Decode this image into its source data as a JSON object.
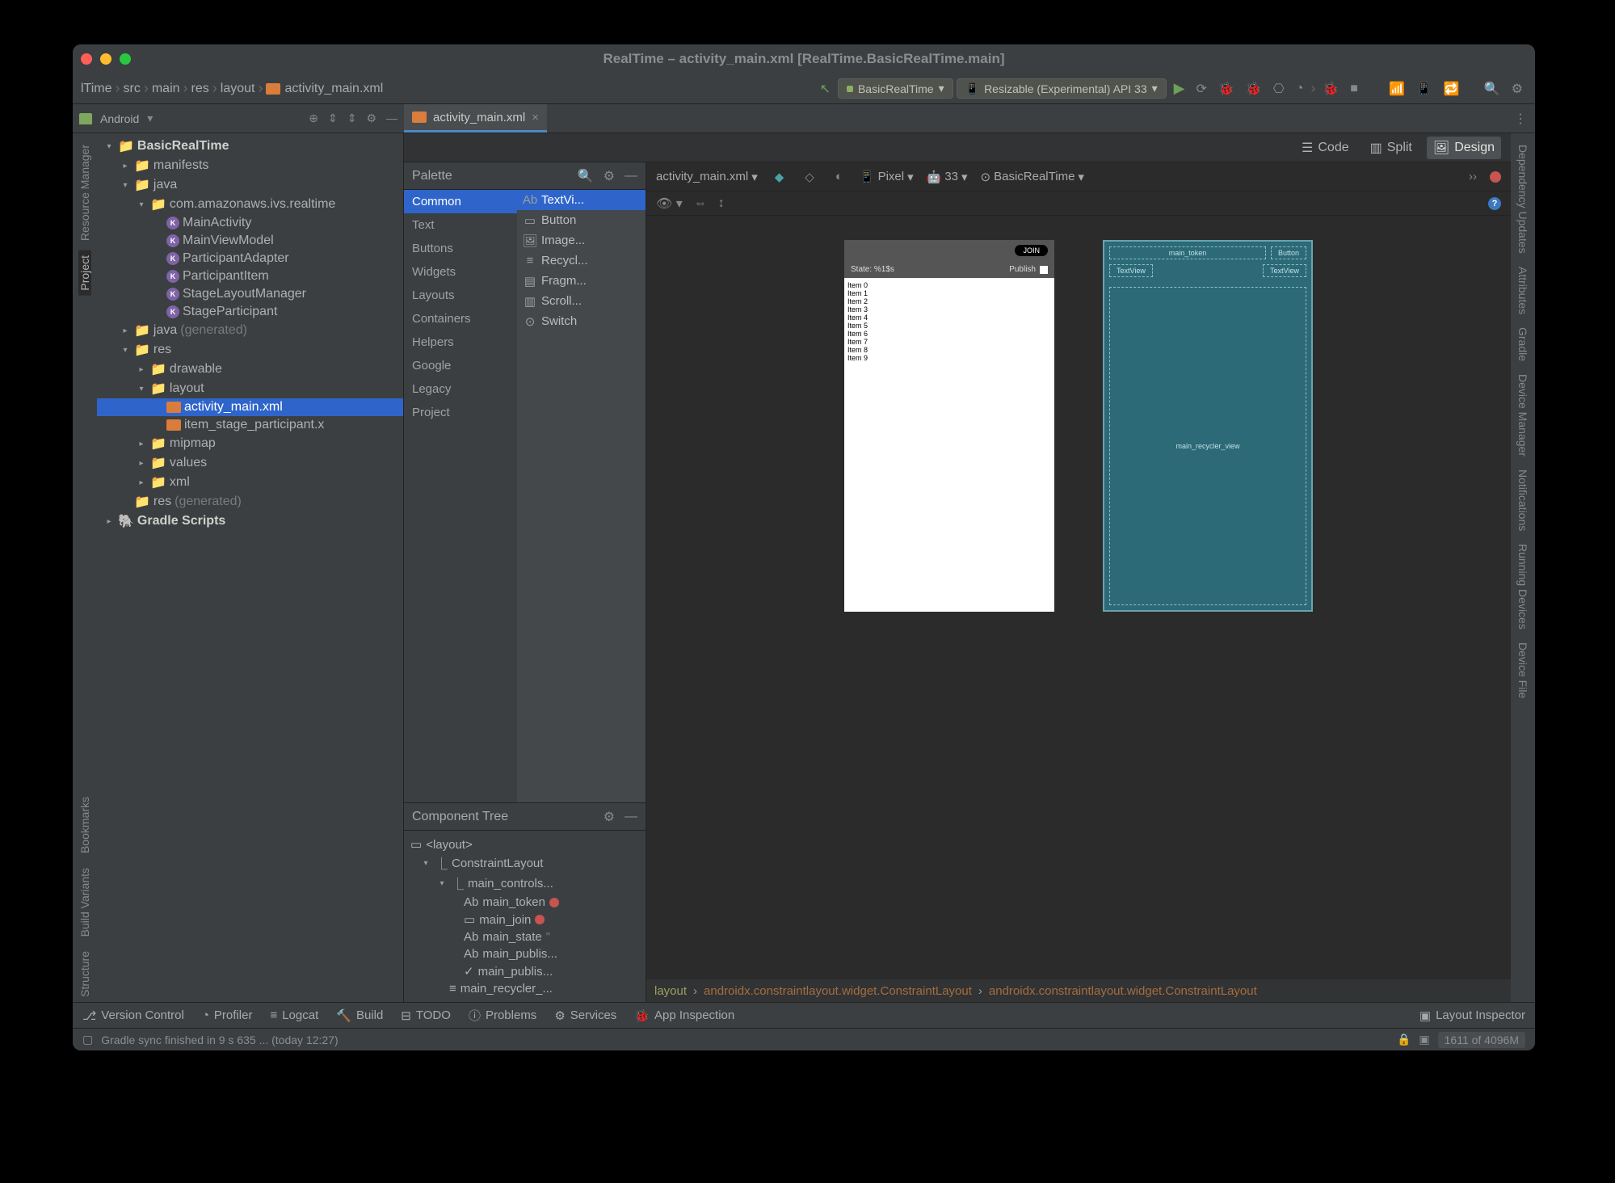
{
  "title": "RealTime – activity_main.xml [RealTime.BasicRealTime.main]",
  "breadcrumbs": {
    "p0": "lTime",
    "p1": "src",
    "p2": "main",
    "p3": "res",
    "p4": "layout",
    "p5": "activity_main.xml"
  },
  "runconfig": {
    "module": "BasicRealTime",
    "device": "Resizable (Experimental) API 33"
  },
  "topbar": {
    "android": "Android",
    "tab": "activity_main.xml"
  },
  "rails_left": {
    "rm": "Resource Manager",
    "prj": "Project",
    "bm": "Bookmarks",
    "bv": "Build Variants",
    "st": "Structure"
  },
  "rails_right": {
    "du": "Dependency Updates",
    "attr": "Attributes",
    "gr": "Gradle",
    "dm": "Device Manager",
    "nt": "Notifications",
    "rd": "Running Devices",
    "df": "Device File"
  },
  "modes": {
    "code": "Code",
    "split": "Split",
    "design": "Design"
  },
  "tree": {
    "root": "BasicRealTime",
    "manifests": "manifests",
    "java": "java",
    "pkg": "com.amazonaws.ivs.realtime",
    "files": {
      "f1": "MainActivity",
      "f2": "MainViewModel",
      "f3": "ParticipantAdapter",
      "f4": "ParticipantItem",
      "f5": "StageLayoutManager",
      "f6": "StageParticipant"
    },
    "java_gen": "java",
    "gen1": "(generated)",
    "res": "res",
    "drawable": "drawable",
    "layout": "layout",
    "lay1": "activity_main.xml",
    "lay2": "item_stage_participant.x",
    "mipmap": "mipmap",
    "values": "values",
    "xml": "xml",
    "res_gen": "res",
    "gen2": "(generated)",
    "gradle": "Gradle Scripts"
  },
  "palette": {
    "title": "Palette",
    "cats": {
      "c0": "Common",
      "c1": "Text",
      "c2": "Buttons",
      "c3": "Widgets",
      "c4": "Layouts",
      "c5": "Containers",
      "c6": "Helpers",
      "c7": "Google",
      "c8": "Legacy",
      "c9": "Project"
    },
    "items": {
      "i0": "TextVi...",
      "i1": "Button",
      "i2": "Image...",
      "i3": "Recycl...",
      "i4": "Fragm...",
      "i5": "Scroll...",
      "i6": "Switch"
    }
  },
  "ctree": {
    "title": "Component Tree",
    "root": "<layout>",
    "c0": "ConstraintLayout",
    "c1": "main_controls...",
    "c2": "main_token",
    "c3": "main_join",
    "c4": "main_state",
    "c4q": "\"",
    "c5": "main_publis...",
    "c6": "main_publis...",
    "c7": "main_recycler_..."
  },
  "designbar": {
    "file": "activity_main.xml",
    "device": "Pixel",
    "api": "33",
    "theme": "BasicRealTime"
  },
  "phone": {
    "join": "JOIN",
    "state": "State: %1$s",
    "publish": "Publish",
    "items": {
      "i0": "Item 0",
      "i1": "Item 1",
      "i2": "Item 2",
      "i3": "Item 3",
      "i4": "Item 4",
      "i5": "Item 5",
      "i6": "Item 6",
      "i7": "Item 7",
      "i8": "Item 8",
      "i9": "Item 9"
    }
  },
  "blueprint": {
    "token": "main_token",
    "button": "Button",
    "tv1": "TextView",
    "tv2": "TextView",
    "rec": "main_recycler_view"
  },
  "bottomcrumb": {
    "b0": "layout",
    "b1": "androidx.constraintlayout.widget.ConstraintLayout",
    "b2": "androidx.constraintlayout.widget.ConstraintLayout"
  },
  "bottombar": {
    "vc": "Version Control",
    "pf": "Profiler",
    "lc": "Logcat",
    "bd": "Build",
    "td": "TODO",
    "pr": "Problems",
    "sv": "Services",
    "ai": "App Inspection",
    "li": "Layout Inspector"
  },
  "status": {
    "msg": "Gradle sync finished in 9 s 635 ... (today 12:27)",
    "mem": "1611 of 4096M"
  }
}
